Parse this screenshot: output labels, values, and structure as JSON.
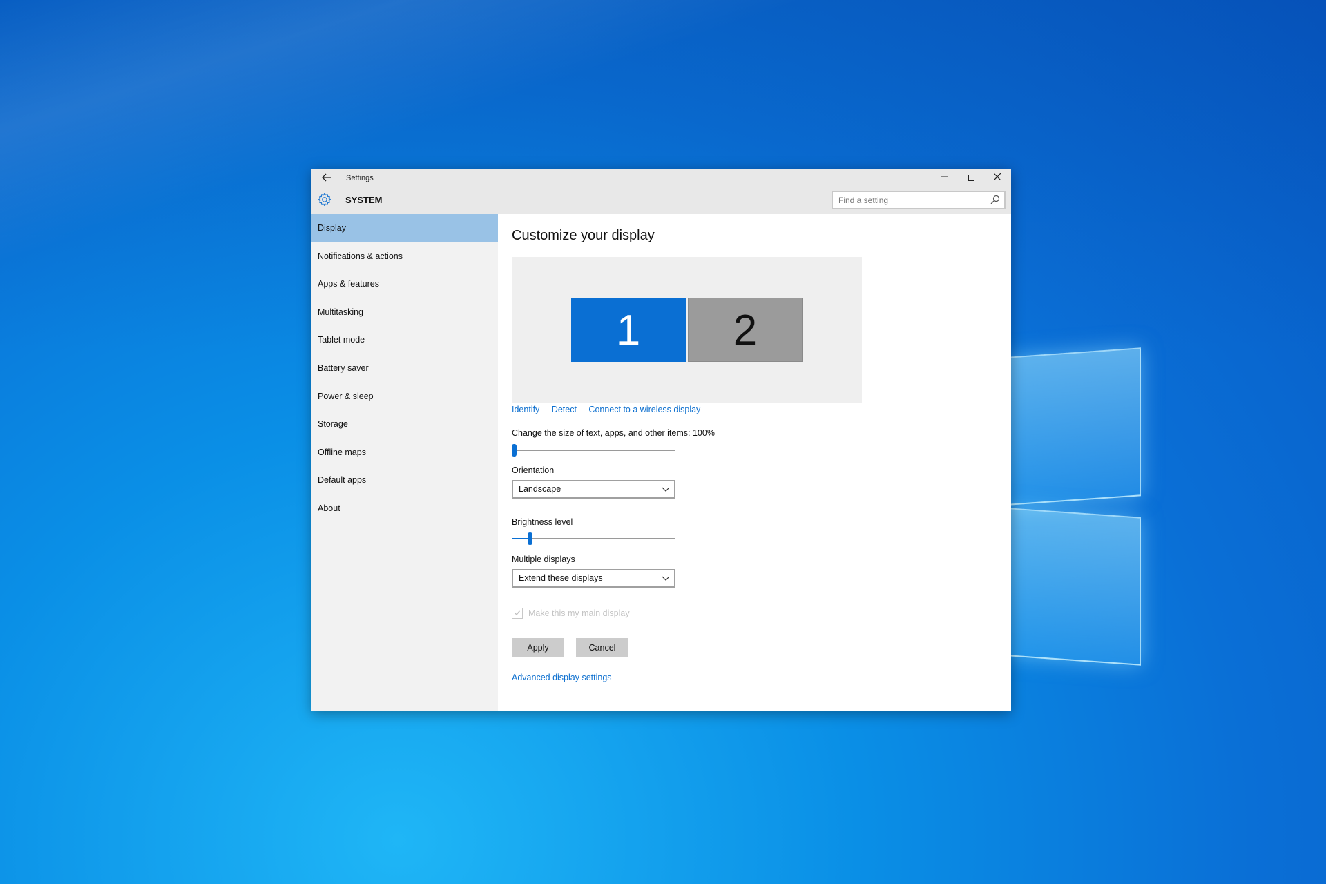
{
  "window": {
    "title": "Settings",
    "section": "SYSTEM"
  },
  "search": {
    "placeholder": "Find a setting"
  },
  "sidebar": {
    "items": [
      {
        "label": "Display",
        "active": true
      },
      {
        "label": "Notifications & actions"
      },
      {
        "label": "Apps & features"
      },
      {
        "label": "Multitasking"
      },
      {
        "label": "Tablet mode"
      },
      {
        "label": "Battery saver"
      },
      {
        "label": "Power & sleep"
      },
      {
        "label": "Storage"
      },
      {
        "label": "Offline maps"
      },
      {
        "label": "Default apps"
      },
      {
        "label": "About"
      }
    ]
  },
  "main": {
    "title": "Customize your display",
    "monitors": [
      {
        "label": "1",
        "selected": true
      },
      {
        "label": "2",
        "selected": false
      }
    ],
    "links": {
      "identify": "Identify",
      "detect": "Detect",
      "wireless": "Connect to a wireless display"
    },
    "scale": {
      "label": "Change the size of text, apps, and other items: 100%",
      "value_fraction": 0.0
    },
    "orientation": {
      "label": "Orientation",
      "selected": "Landscape"
    },
    "brightness": {
      "label": "Brightness level",
      "value_fraction": 0.1
    },
    "multiple_displays": {
      "label": "Multiple displays",
      "selected": "Extend these displays"
    },
    "main_display_checkbox": {
      "label": "Make this my main display",
      "checked": true,
      "disabled": true
    },
    "buttons": {
      "apply": "Apply",
      "cancel": "Cancel"
    },
    "advanced_link": "Advanced display settings"
  },
  "colors": {
    "accent": "#0a6fd3",
    "active_nav": "#99c2e6",
    "monitor_inactive": "#9b9b9b"
  }
}
